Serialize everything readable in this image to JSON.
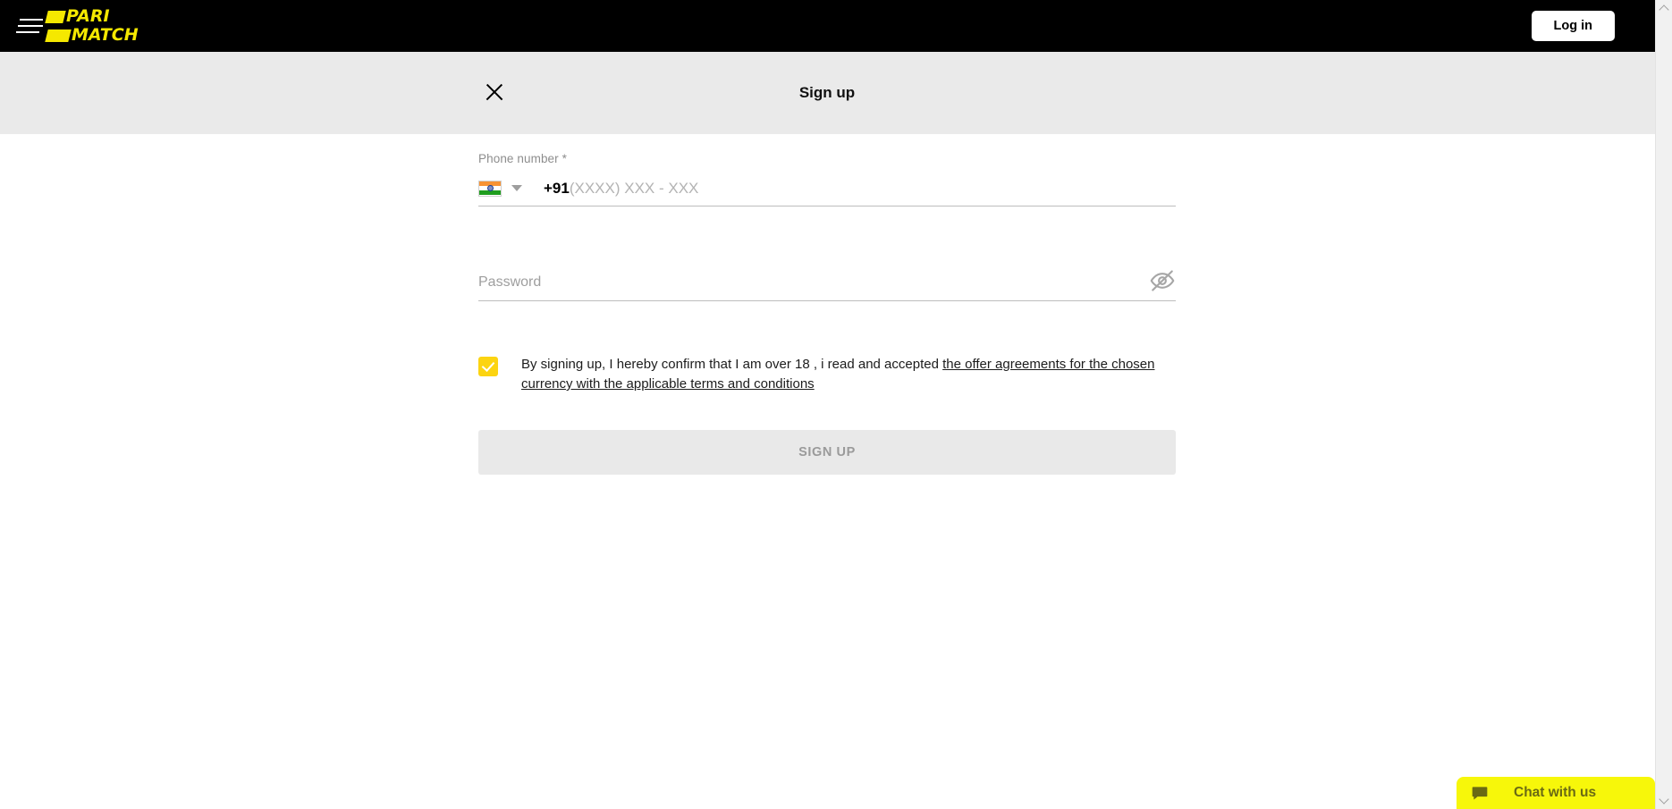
{
  "topbar": {
    "menu_icon": "hamburger-menu-icon",
    "logo": {
      "line1": "PARI",
      "line2": "MATCH",
      "color": "#f5e800"
    },
    "login_label": "Log in"
  },
  "modal": {
    "title": "Sign up",
    "close_icon": "close-x-icon",
    "header_bg": "#eaeaea"
  },
  "form": {
    "phone": {
      "label": "Phone number *",
      "country_flag": "india-flag-icon",
      "dropdown_icon": "chevron-down-icon",
      "dial_code": "+91",
      "placeholder": "(XXXX) XXX - XXX",
      "value": ""
    },
    "password": {
      "placeholder": "Password",
      "value": "",
      "toggle_icon": "eye-off-icon"
    },
    "consent": {
      "checked": true,
      "checkbox_color": "#fcd411",
      "text_before": "By signing up, I hereby confirm that I am over 18 , i read and accepted ",
      "link_text": "the offer agreements for the chosen currency with the applicable terms and conditions"
    },
    "submit": {
      "label": "SIGN UP",
      "disabled": true,
      "bg": "#e9e9e9",
      "text_color": "#9a9a9a"
    }
  },
  "chat": {
    "label": "Chat with us",
    "icon": "chat-bubble-icon",
    "bg": "#f7f70a",
    "text_color": "#6a6a14"
  },
  "scrollbar": {
    "up_icon": "scroll-up-arrow-icon",
    "down_icon": "scroll-down-arrow-icon"
  }
}
